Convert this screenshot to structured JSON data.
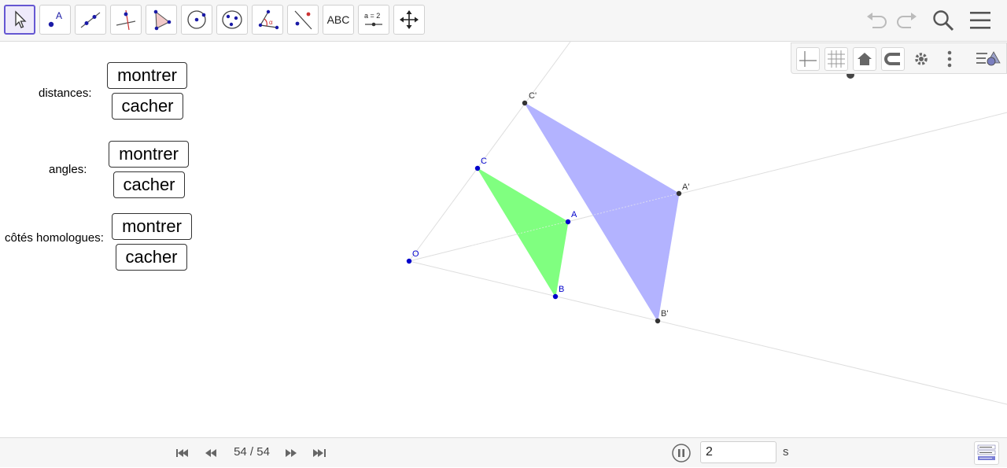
{
  "toolbar": {
    "tools": [
      {
        "name": "move"
      },
      {
        "name": "point",
        "glyph": "A"
      },
      {
        "name": "line"
      },
      {
        "name": "perpendicular"
      },
      {
        "name": "polygon"
      },
      {
        "name": "circle"
      },
      {
        "name": "ellipse"
      },
      {
        "name": "angle",
        "glyph": "α"
      },
      {
        "name": "reflect"
      },
      {
        "name": "text",
        "label": "ABC"
      },
      {
        "name": "slider",
        "label": "a = 2"
      },
      {
        "name": "move-graphics-view"
      }
    ],
    "right_icons": [
      "undo-icon",
      "redo-icon",
      "search-icon",
      "menu-icon"
    ]
  },
  "graphics_style_bar": {
    "icons": [
      "axes-icon",
      "grid-icon",
      "home-icon",
      "point-capture-icon",
      "settings-icon",
      "more-icon",
      "style-bar-toggle-icon"
    ]
  },
  "controls": {
    "distances": {
      "label": "distances:",
      "show": "montrer",
      "hide": "cacher"
    },
    "angles": {
      "label": "angles:",
      "show": "montrer",
      "hide": "cacher"
    },
    "homologous_sides": {
      "label": "côtés homologues:",
      "show": "montrer",
      "hide": "cacher"
    }
  },
  "geometry": {
    "points": {
      "O": "O",
      "A": "A",
      "B": "B",
      "C": "C",
      "A_prime": "A'",
      "B_prime": "B'",
      "C_prime": "C'"
    },
    "colors": {
      "original_triangle": "#80ff80",
      "image_triangle": "#b3b3ff",
      "original_points": "#0000cc",
      "image_points": "#333333",
      "construction_lines": "#d9d9d9"
    }
  },
  "playback": {
    "step": "54 / 54",
    "speed_value": "2",
    "speed_unit": "s"
  },
  "colors": {
    "accent": "#6557d2",
    "toolbar_bg": "#f6f6f6"
  }
}
